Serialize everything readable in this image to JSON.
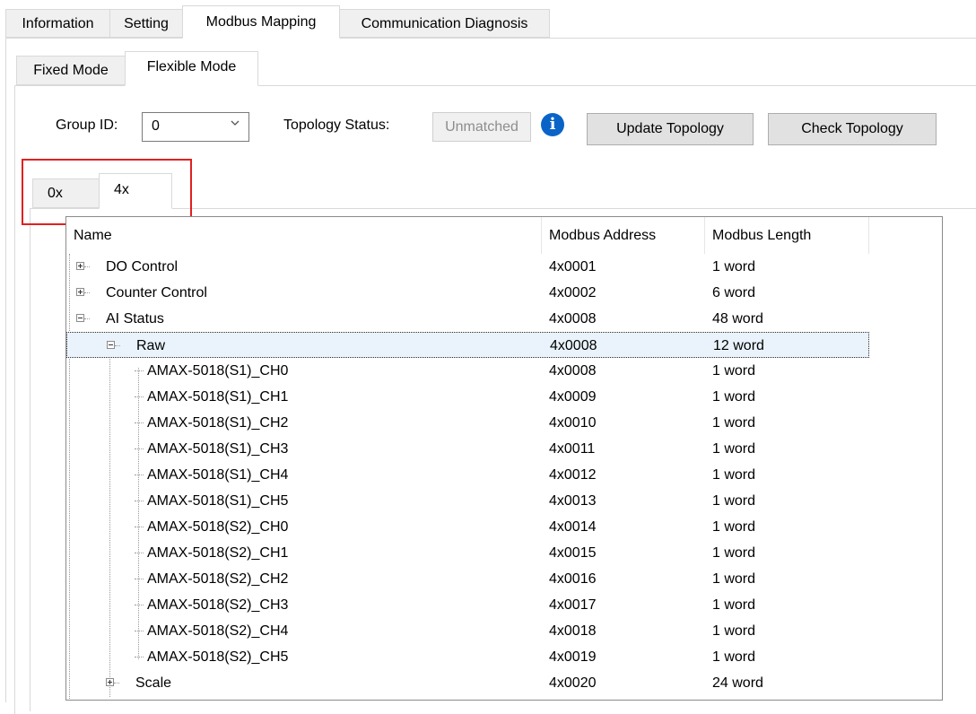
{
  "main_tabs": [
    "Information",
    "Setting",
    "Modbus Mapping",
    "Communication Diagnosis"
  ],
  "sub_tabs": [
    "Fixed Mode",
    "Flexible Mode"
  ],
  "controls": {
    "group_id_label": "Group ID:",
    "group_id_value": "0",
    "topology_status_label": "Topology Status:",
    "topology_status_value": "Unmatched",
    "update_topology_button": "Update Topology",
    "check_topology_button": "Check Topology",
    "info_glyph": "i"
  },
  "register_tabs": [
    "0x",
    "4x"
  ],
  "table": {
    "headers": [
      "Name",
      "Modbus Address",
      "Modbus Length"
    ],
    "rows": [
      {
        "name": "DO Control",
        "address": "4x0001",
        "length": "1 word"
      },
      {
        "name": "Counter Control",
        "address": "4x0002",
        "length": "6 word"
      },
      {
        "name": "AI Status",
        "address": "4x0008",
        "length": "48 word"
      },
      {
        "name": "Raw",
        "address": "4x0008",
        "length": "12 word"
      },
      {
        "name": "AMAX-5018(S1)_CH0",
        "address": "4x0008",
        "length": "1 word"
      },
      {
        "name": "AMAX-5018(S1)_CH1",
        "address": "4x0009",
        "length": "1 word"
      },
      {
        "name": "AMAX-5018(S1)_CH2",
        "address": "4x0010",
        "length": "1 word"
      },
      {
        "name": "AMAX-5018(S1)_CH3",
        "address": "4x0011",
        "length": "1 word"
      },
      {
        "name": "AMAX-5018(S1)_CH4",
        "address": "4x0012",
        "length": "1 word"
      },
      {
        "name": "AMAX-5018(S1)_CH5",
        "address": "4x0013",
        "length": "1 word"
      },
      {
        "name": "AMAX-5018(S2)_CH0",
        "address": "4x0014",
        "length": "1 word"
      },
      {
        "name": "AMAX-5018(S2)_CH1",
        "address": "4x0015",
        "length": "1 word"
      },
      {
        "name": "AMAX-5018(S2)_CH2",
        "address": "4x0016",
        "length": "1 word"
      },
      {
        "name": "AMAX-5018(S2)_CH3",
        "address": "4x0017",
        "length": "1 word"
      },
      {
        "name": "AMAX-5018(S2)_CH4",
        "address": "4x0018",
        "length": "1 word"
      },
      {
        "name": "AMAX-5018(S2)_CH5",
        "address": "4x0019",
        "length": "1 word"
      },
      {
        "name": "Scale",
        "address": "4x0020",
        "length": "24 word"
      }
    ]
  },
  "colors": {
    "highlight_box": "#e02020",
    "info_icon": "#0a64c8",
    "selected_row_bg": "#eaf3fc"
  },
  "icons": {
    "info": "info-icon",
    "dropdown": "chevron-down-icon",
    "expand": "plus-box-icon",
    "collapse": "minus-box-icon"
  }
}
